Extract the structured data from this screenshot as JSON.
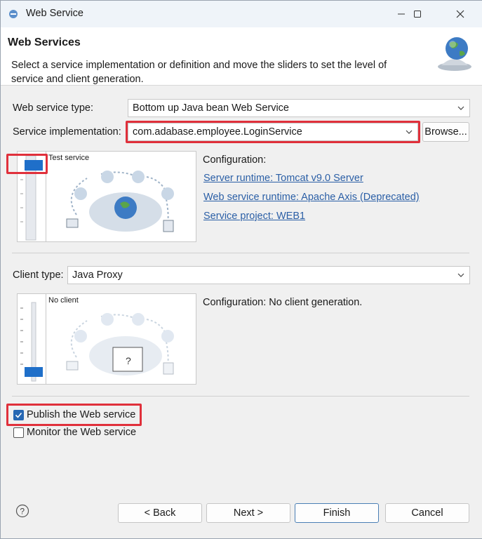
{
  "window": {
    "title": "Web Service"
  },
  "header": {
    "title": "Web Services",
    "description": "Select a service implementation or definition and move the sliders to set the level of service and client generation."
  },
  "service": {
    "type_label": "Web service type:",
    "type_value": "Bottom up Java bean Web Service",
    "impl_label": "Service implementation:",
    "impl_value": "com.adabase.employee.LoginService",
    "browse_label": "Browse...",
    "slider_caption": "Test service",
    "config_label": "Configuration:",
    "links": [
      "Server runtime: Tomcat v9.0 Server",
      "Web service runtime: Apache Axis (Deprecated)",
      "Service project: WEB1"
    ]
  },
  "client": {
    "type_label": "Client type:",
    "type_value": "Java Proxy",
    "slider_caption": "No client",
    "config_text": "Configuration: No client generation."
  },
  "options": {
    "publish_label": "Publish the Web service",
    "publish_checked": true,
    "monitor_label": "Monitor the Web service",
    "monitor_checked": false
  },
  "buttons": {
    "back": "< Back",
    "next": "Next >",
    "finish": "Finish",
    "cancel": "Cancel"
  },
  "colors": {
    "accent": "#2667b3",
    "highlight": "#e0303b",
    "link": "#2b5fa6"
  }
}
